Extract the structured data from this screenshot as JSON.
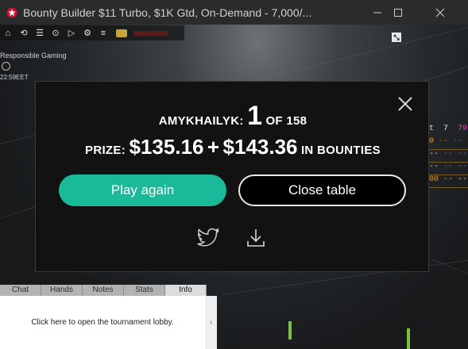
{
  "window": {
    "title": "Bounty Builder $11 Turbo, $1K Gtd, On-Demand - 7,000/..."
  },
  "toolbar": {
    "responsible_gaming": "Responsible Gaming",
    "clock": "22:59EET",
    "icons": [
      "home-icon",
      "rebuy-icon",
      "lobby-icon",
      "options-icon",
      "replay-icon",
      "settings-icon",
      "notes-icon",
      "chips-icon"
    ]
  },
  "stats": {
    "header": [
      "t",
      "7",
      "79"
    ],
    "rows": [
      [
        "0",
        "--",
        "--"
      ],
      [
        "--",
        "--",
        "--"
      ],
      [
        "--",
        "--",
        "--"
      ],
      [
        "00",
        "--",
        "--"
      ]
    ]
  },
  "result": {
    "player": "AMYKHAILYK:",
    "rank": "1",
    "of_label": "OF",
    "total": "158",
    "prize_label": "PRIZE:",
    "prize": "$135.16",
    "plus": "+",
    "bounties": "$143.36",
    "bounties_label": "IN BOUNTIES"
  },
  "buttons": {
    "play_again": "Play again",
    "close_table": "Close table"
  },
  "panel": {
    "tabs": [
      "Chat",
      "Hands",
      "Notes",
      "Stats",
      "Info"
    ],
    "active_tab": "Info",
    "message": "Click here to open the tournament lobby.",
    "collapse": "‹"
  },
  "colors": {
    "accent": "#19b99a",
    "modal_bg": "#121212"
  }
}
